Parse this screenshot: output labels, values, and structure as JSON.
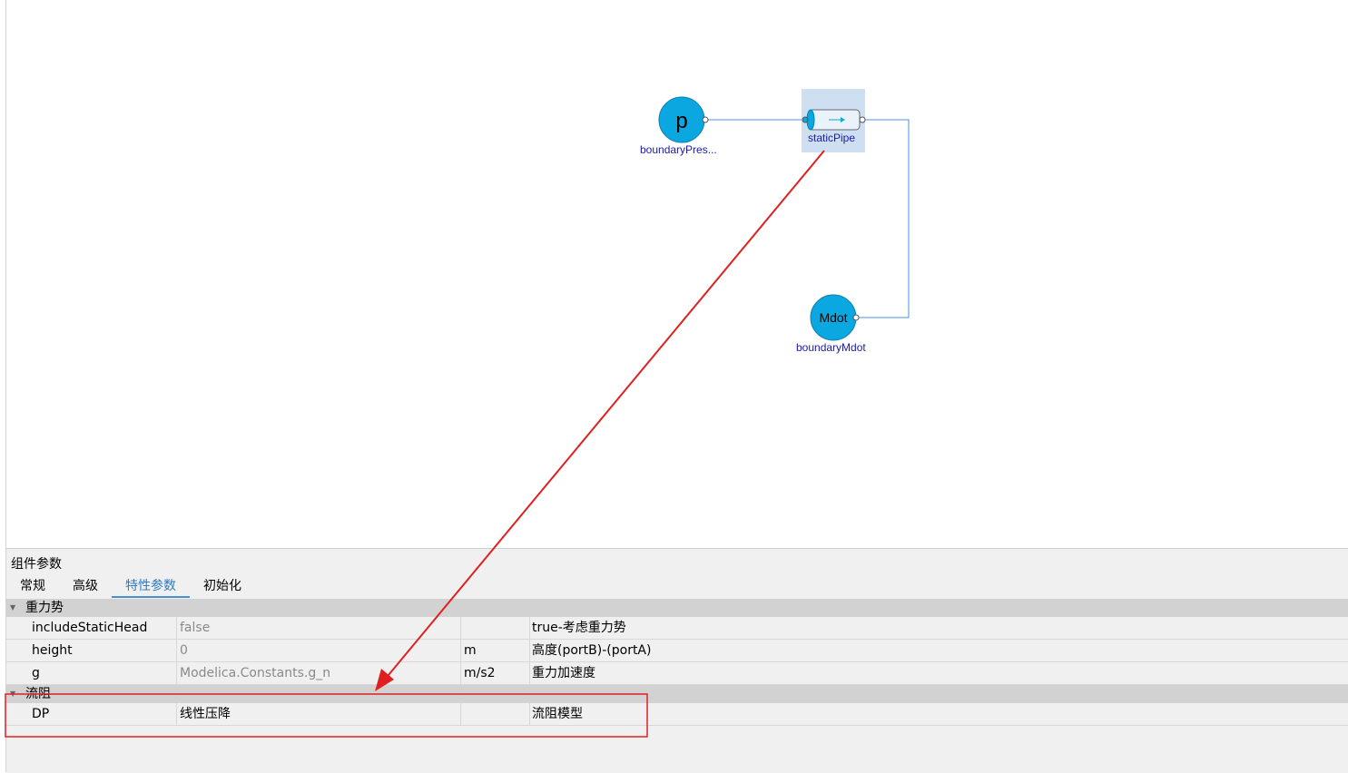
{
  "diagram": {
    "components": [
      {
        "id": "boundaryPressure",
        "symbol": "p",
        "label": "boundaryPres..."
      },
      {
        "id": "staticPipe",
        "label": "staticPipe"
      },
      {
        "id": "boundaryMdot",
        "symbol": "Mdot",
        "label": "boundaryMdot"
      }
    ]
  },
  "panel": {
    "title": "组件参数",
    "tabs": [
      {
        "label": "常规",
        "active": false
      },
      {
        "label": "高级",
        "active": false
      },
      {
        "label": "特性参数",
        "active": true
      },
      {
        "label": "初始化",
        "active": false
      }
    ],
    "groups": [
      {
        "name": "重力势",
        "rows": [
          {
            "name": "includeStaticHead",
            "value": "false",
            "unit": "",
            "description": "true-考虑重力势"
          },
          {
            "name": "height",
            "value": "0",
            "unit": "m",
            "description": "高度(portB)-(portA)"
          },
          {
            "name": "g",
            "value": "Modelica.Constants.g_n",
            "unit": "m/s2",
            "description": "重力加速度"
          }
        ]
      },
      {
        "name": "流阻",
        "rows": [
          {
            "name": "DP",
            "value": "线性压降",
            "unit": "",
            "description": "流阻模型"
          }
        ]
      }
    ]
  },
  "colors": {
    "component_fill": "#0aa7e0",
    "connection_line": "#4a90e2",
    "label_text": "#1a1aa8",
    "selection": "#cddff0",
    "annotation_red": "#e02020",
    "active_tab": "#2b7bc6"
  }
}
